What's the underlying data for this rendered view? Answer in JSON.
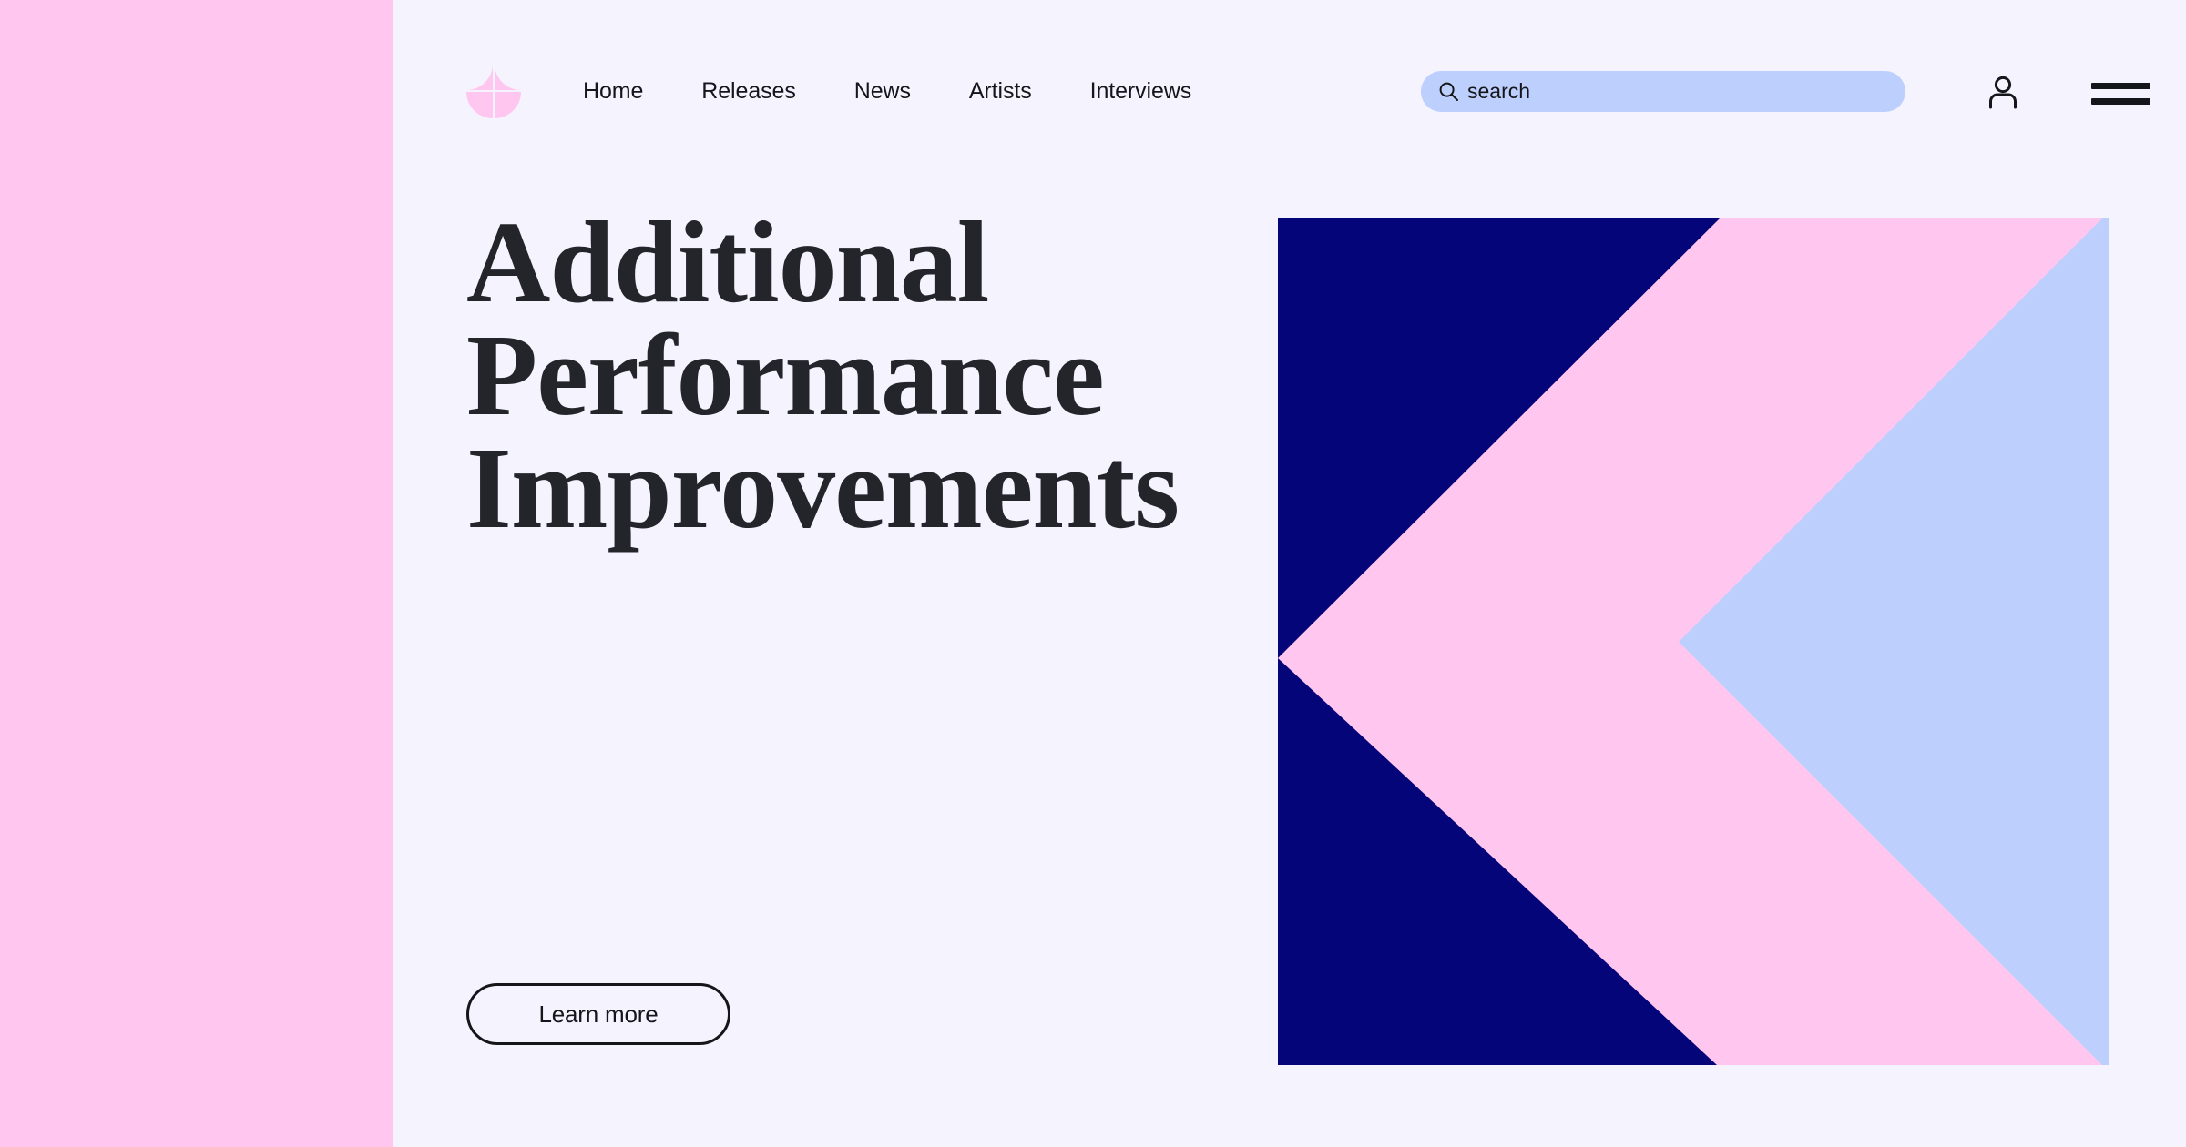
{
  "brand": {
    "logo_icon": "four-petal-logo-icon",
    "logo_color": "#ffc7ef"
  },
  "nav": {
    "items": [
      {
        "label": "Home"
      },
      {
        "label": "Releases"
      },
      {
        "label": "News"
      },
      {
        "label": "Artists"
      },
      {
        "label": "Interviews"
      }
    ]
  },
  "search": {
    "icon": "search-icon",
    "value": "",
    "placeholder": "search",
    "background": "#bdd0fd"
  },
  "header_actions": {
    "account_icon": "user-account-icon",
    "menu_icon": "hamburger-menu-icon"
  },
  "hero": {
    "title_line_1": "Additional",
    "title_line_2": "Performance",
    "title_line_3": "Improvements",
    "cta_label": "Learn more"
  },
  "artwork": {
    "name": "chevron-geometric-artwork",
    "colors": {
      "navy": "#05057a",
      "pink": "#ffc7ef",
      "light_blue": "#bdd0fd"
    }
  },
  "theme": {
    "page_background": "#f5f3fd",
    "side_rail": "#ffc7ef",
    "text": "#15161a",
    "heading": "#24252b"
  }
}
